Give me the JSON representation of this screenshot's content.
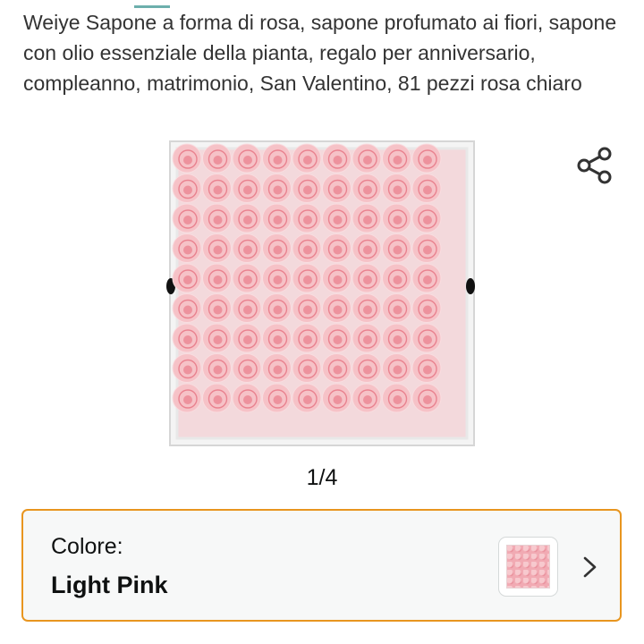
{
  "product": {
    "title": "Weiye Sapone a forma di rosa, sapone profumato ai fiori, sapone con olio essenziale della pianta, regalo per anniversario, compleanno, matrimonio, San Valentino, 81 pezzi rosa chiaro",
    "image_counter": "1/4"
  },
  "variant": {
    "label": "Colore:",
    "value": "Light Pink"
  },
  "icons": {
    "share": "share-icon",
    "chevron": "chevron-right-icon"
  },
  "colors": {
    "accent_border": "#e8951f",
    "card_background": "#f7f8f8",
    "rose_light": "#f6c2c7",
    "rose_dark": "#e9828f"
  }
}
